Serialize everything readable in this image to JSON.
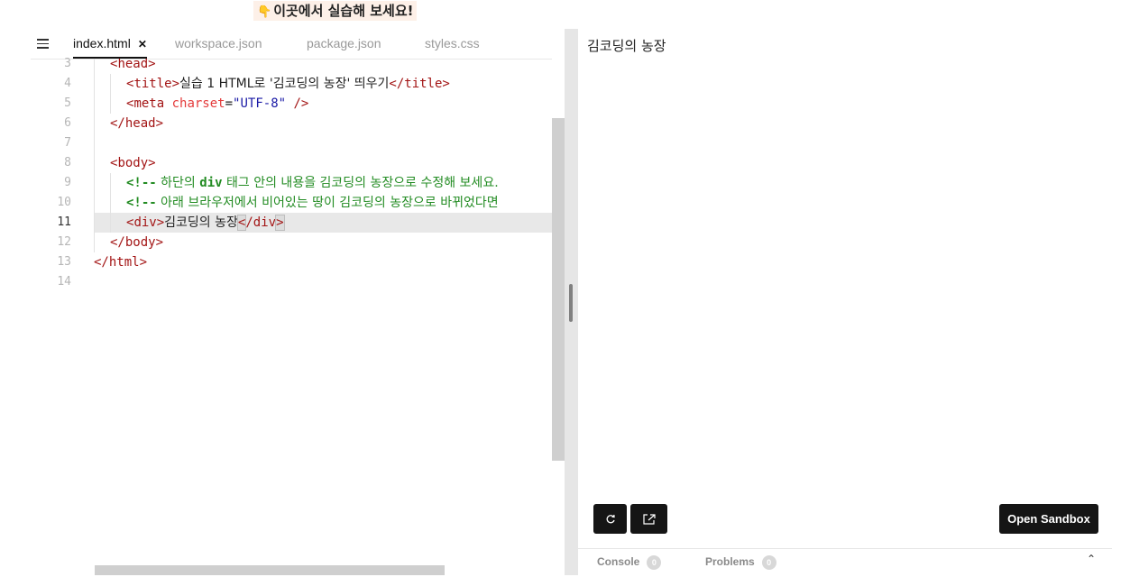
{
  "banner": {
    "text": "이곳에서 실습해 보세요!",
    "icon": "pointing-hand-icon"
  },
  "editor": {
    "tabs": [
      {
        "label": "index.html",
        "active": true
      },
      {
        "label": "workspace.json"
      },
      {
        "label": "package.json"
      },
      {
        "label": "styles.css"
      }
    ],
    "current_line": 11,
    "lines": [
      {
        "no": "3",
        "text": "<head>"
      },
      {
        "no": "4",
        "text": "<title>실습 1 HTML로 '김코딩의 농장' 띄우기</title>"
      },
      {
        "no": "5",
        "text": "<meta charset=\"UTF-8\" />"
      },
      {
        "no": "6",
        "text": "</head>"
      },
      {
        "no": "7",
        "text": ""
      },
      {
        "no": "8",
        "text": "<body>"
      },
      {
        "no": "9",
        "text": "<!-- 하단의 div 태그 안의 내용을 김코딩의 농장으로 수정해 보세요."
      },
      {
        "no": "10",
        "text": "<!-- 아래 브라우저에서 비어있는 땅이 김코딩의 농장으로 바뀌었다면"
      },
      {
        "no": "11",
        "text": "<div>김코딩의 농장</div>"
      },
      {
        "no": "12",
        "text": "</body>"
      },
      {
        "no": "13",
        "text": "</html>"
      },
      {
        "no": "14",
        "text": ""
      }
    ],
    "code": {
      "l3_tag": "head",
      "l4_tag": "title",
      "l4_content": "실습 1 HTML로 '김코딩의 농장' 띄우기",
      "l5_tag": "meta",
      "l5_attr": "charset",
      "l5_value": "\"UTF-8\"",
      "l6_tag": "head",
      "l8_tag": "body",
      "l9_open": "<!--",
      "l9_pre": " 하단의 ",
      "l9_kw": "div",
      "l9_post": " 태그 안의 내용을 김코딩의 농장으로 수정해 보세요.",
      "l10_open": "<!--",
      "l10_text": " 아래 브라우저에서 비어있는 땅이 김코딩의 농장으로 바뀌었다면",
      "l11_tag": "div",
      "l11_content": "김코딩의 농장",
      "l12_tag": "body",
      "l13_tag": "html"
    }
  },
  "preview": {
    "text": "김코딩의 농장",
    "open_sandbox_label": "Open Sandbox",
    "bottom_tabs": [
      {
        "label": "Console",
        "count": "0"
      },
      {
        "label": "Problems",
        "count": "0"
      }
    ]
  },
  "colors": {
    "tag": "#a31515",
    "attr": "#e43b3b",
    "string": "#1a1aa6",
    "comment": "#238c23",
    "button_bg": "#151515",
    "current_line_bg": "#e8e8e8"
  }
}
